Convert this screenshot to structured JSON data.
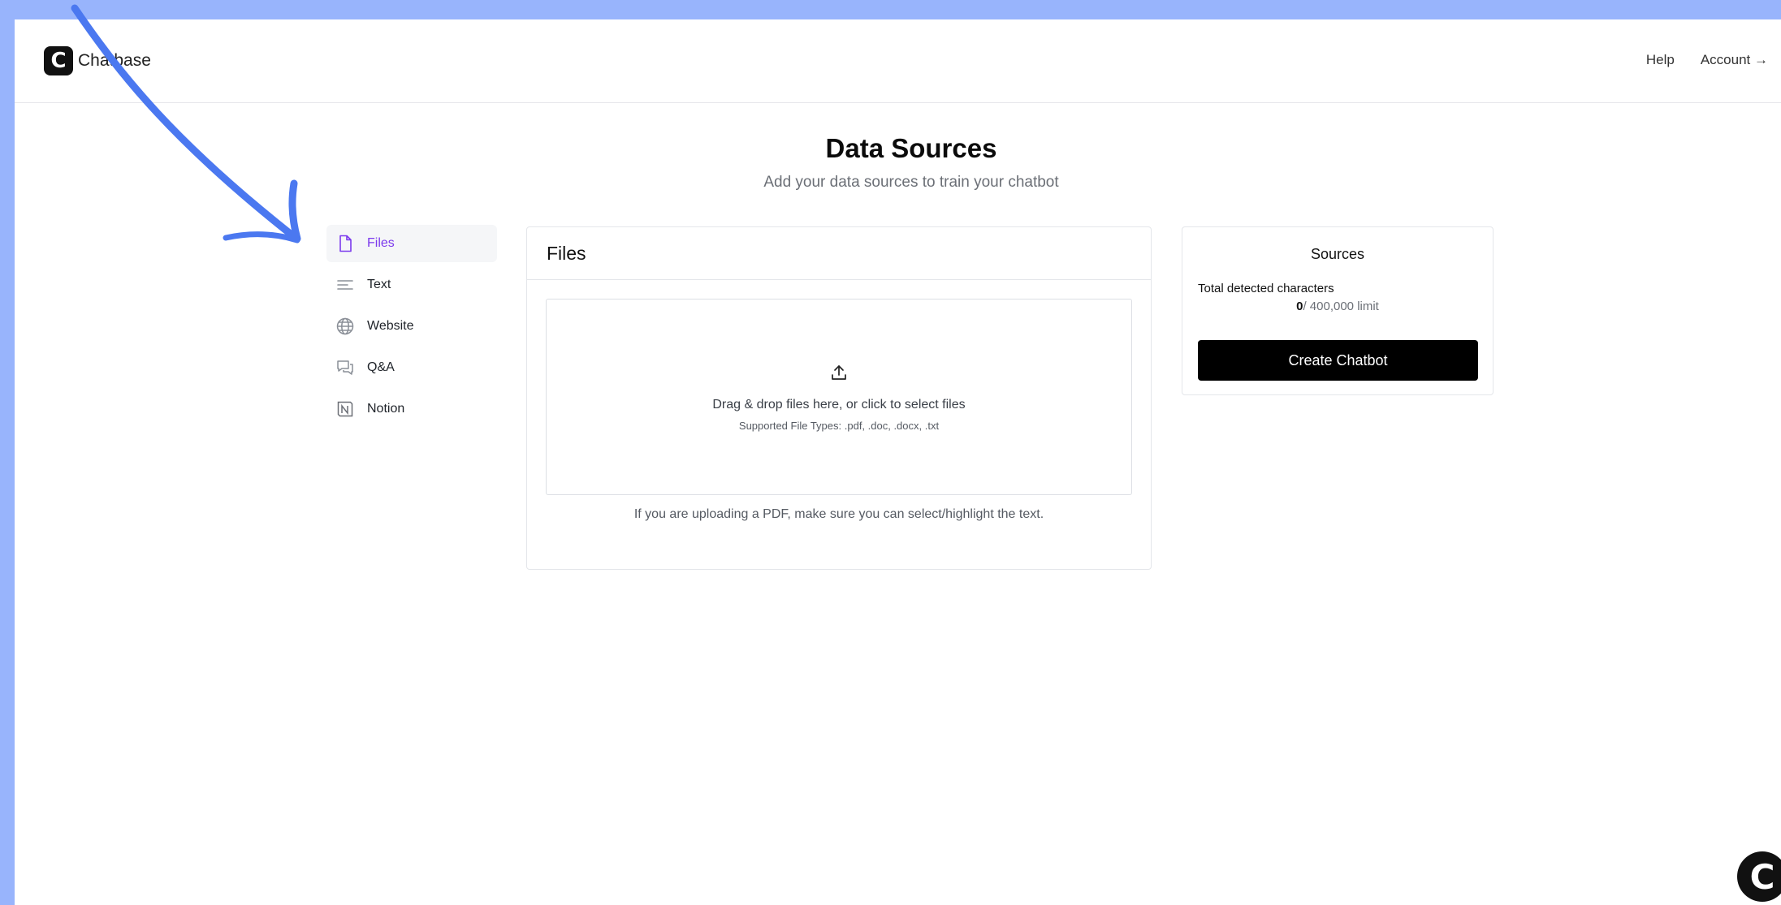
{
  "header": {
    "logo_letter": "C",
    "brand": "Chatbase",
    "nav": [
      {
        "label": "Help"
      },
      {
        "label": "Account →"
      }
    ]
  },
  "page": {
    "title": "Data Sources",
    "subtitle": "Add your data sources to train your chatbot"
  },
  "sidebar": {
    "items": [
      {
        "label": "Files",
        "icon": "file-icon",
        "active": true
      },
      {
        "label": "Text",
        "icon": "text-lines-icon"
      },
      {
        "label": "Website",
        "icon": "globe-icon"
      },
      {
        "label": "Q&A",
        "icon": "chat-bubbles-icon"
      },
      {
        "label": "Notion",
        "icon": "notion-icon"
      }
    ]
  },
  "files_panel": {
    "title": "Files",
    "dropzone_text": "Drag & drop files here, or click to select files",
    "supported_types": "Supported File Types: .pdf, .doc, .docx, .txt",
    "pdf_note": "If you are uploading a PDF, make sure you can select/highlight the text."
  },
  "sources_panel": {
    "title": "Sources",
    "total_label": "Total detected characters",
    "count": "0",
    "limit": "/ 400,000 limit",
    "create_button": "Create Chatbot"
  },
  "chat_badge": {
    "letter": "C"
  },
  "colors": {
    "background": "#98b4fc",
    "accent": "#7c3aed",
    "annotation_arrow": "#4b78f0"
  }
}
